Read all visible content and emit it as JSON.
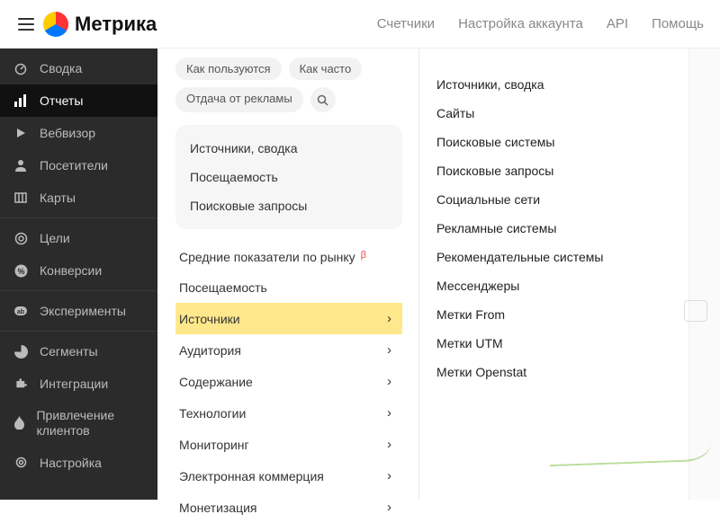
{
  "brand": "Метрика",
  "header_nav": {
    "counters": "Счетчики",
    "account": "Настройка аккаунта",
    "api": "API",
    "help": "Помощь"
  },
  "sidebar": {
    "items": [
      {
        "label": "Сводка"
      },
      {
        "label": "Отчеты"
      },
      {
        "label": "Вебвизор"
      },
      {
        "label": "Посетители"
      },
      {
        "label": "Карты"
      },
      {
        "label": "Цели"
      },
      {
        "label": "Конверсии"
      },
      {
        "label": "Эксперименты"
      },
      {
        "label": "Сегменты"
      },
      {
        "label": "Интеграции"
      },
      {
        "label": "Привлечение клиентов"
      },
      {
        "label": "Настройка"
      }
    ]
  },
  "chips": {
    "how_use": "Как пользуются",
    "how_often": "Как часто",
    "ad_return": "Отдача от рекламы"
  },
  "gray_panel": {
    "sources_summary": "Источники, сводка",
    "visits": "Посещаемость",
    "search_queries": "Поисковые запросы"
  },
  "report_list": {
    "market_avg": "Средние показатели по рынку",
    "market_beta": "β",
    "visits": "Посещаемость",
    "sources": "Источники",
    "audience": "Аудитория",
    "content": "Содержание",
    "technologies": "Технологии",
    "monitoring": "Мониторинг",
    "ecommerce": "Электронная коммерция",
    "monetization": "Монетизация"
  },
  "submenu": {
    "sources_summary": "Источники, сводка",
    "sites": "Сайты",
    "search_engines": "Поисковые системы",
    "search_queries": "Поисковые запросы",
    "social": "Социальные сети",
    "ad_systems": "Рекламные системы",
    "recommendation": "Рекомендательные системы",
    "messengers": "Мессенджеры",
    "from_tags": "Метки From",
    "utm_tags": "Метки UTM",
    "openstat_tags": "Метки Openstat"
  }
}
